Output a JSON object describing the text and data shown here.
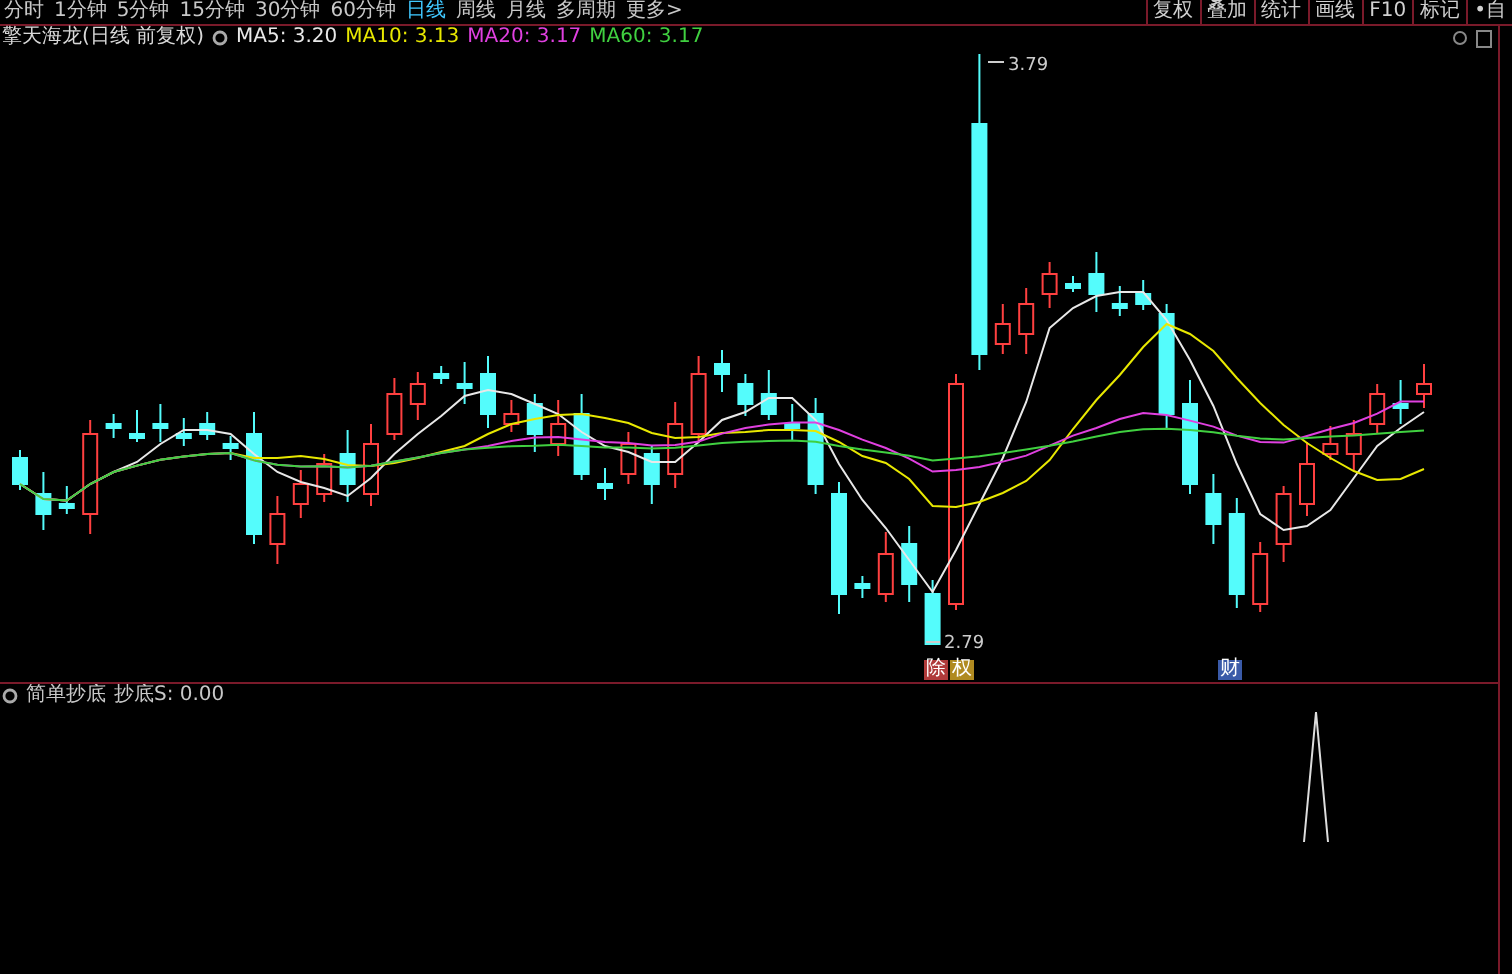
{
  "period_tabs": [
    {
      "label": "分时",
      "selected": false
    },
    {
      "label": "1分钟",
      "selected": false
    },
    {
      "label": "5分钟",
      "selected": false
    },
    {
      "label": "15分钟",
      "selected": false
    },
    {
      "label": "30分钟",
      "selected": false
    },
    {
      "label": "60分钟",
      "selected": false
    },
    {
      "label": "日线",
      "selected": true
    },
    {
      "label": "周线",
      "selected": false
    },
    {
      "label": "月线",
      "selected": false
    },
    {
      "label": "多周期",
      "selected": false
    },
    {
      "label": "更多>",
      "selected": false
    }
  ],
  "toolbar_buttons": [
    "复权",
    "叠加",
    "统计",
    "画线",
    "F10",
    "标记",
    "•自"
  ],
  "chart_title": "擎天海龙(日线 前复权)",
  "moving_averages": [
    {
      "label": "MA5: 3.20",
      "color": "#e8e8e8"
    },
    {
      "label": "MA10: 3.13",
      "color": "#e8e800"
    },
    {
      "label": "MA20: 3.17",
      "color": "#e040e0"
    },
    {
      "label": "MA60: 3.17",
      "color": "#40d040"
    }
  ],
  "price_chart": {
    "high_label": "3.79",
    "low_label": "2.79"
  },
  "event_markers": [
    {
      "label": "除",
      "color": "#b03a3a"
    },
    {
      "label": "权",
      "color": "#b08a20"
    },
    {
      "label": "财",
      "color": "#3a5aa8"
    }
  ],
  "indicator": {
    "name": "简单抄底",
    "reading": "抄底S: 0.00"
  }
}
